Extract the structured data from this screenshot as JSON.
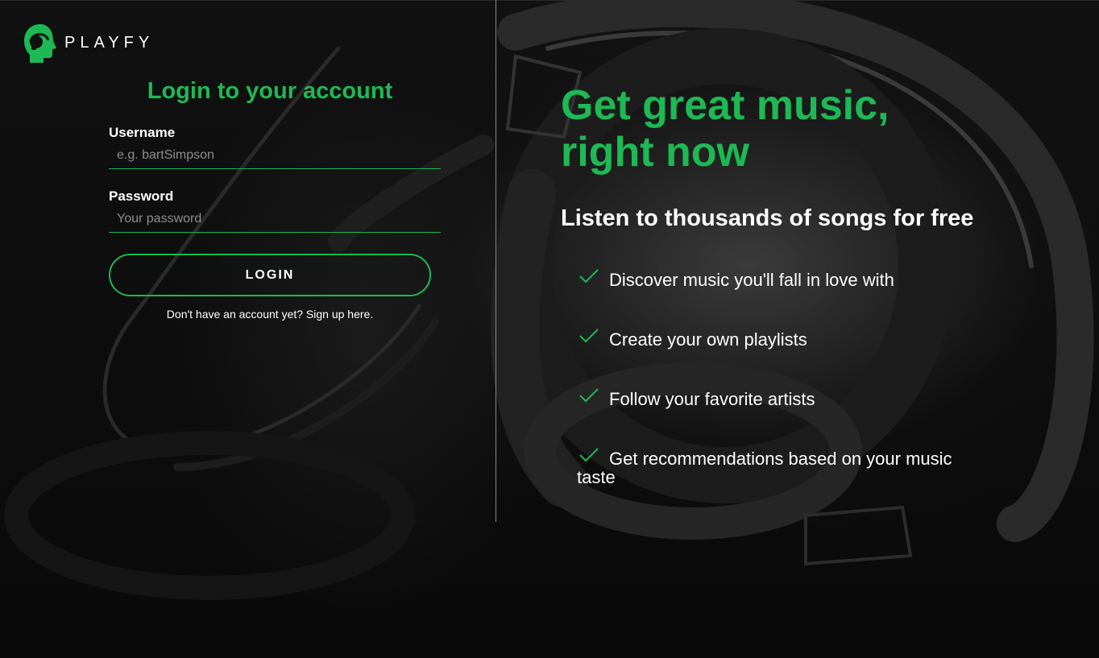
{
  "brand": {
    "name": "PLAYFY",
    "accent": "#1db954"
  },
  "login": {
    "title": "Login to your account",
    "username_label": "Username",
    "username_placeholder": "e.g. bartSimpson",
    "password_label": "Password",
    "password_placeholder": "Your password",
    "login_button": "LOGIN",
    "signup_text": "Don't have an account yet? Sign up here."
  },
  "hero": {
    "title_line1": "Get great music,",
    "title_line2": "right now",
    "subtitle": "Listen to thousands of songs for free",
    "features": [
      {
        "icon": "check-icon",
        "text": "Discover music you'll fall in love with"
      },
      {
        "icon": "check-icon",
        "text": "Create your own playlists"
      },
      {
        "icon": "check-icon",
        "text": "Follow your favorite artists"
      },
      {
        "icon": "check-icon",
        "text_line1": "Get recommendations based on your music",
        "text_line2": "taste"
      }
    ]
  }
}
